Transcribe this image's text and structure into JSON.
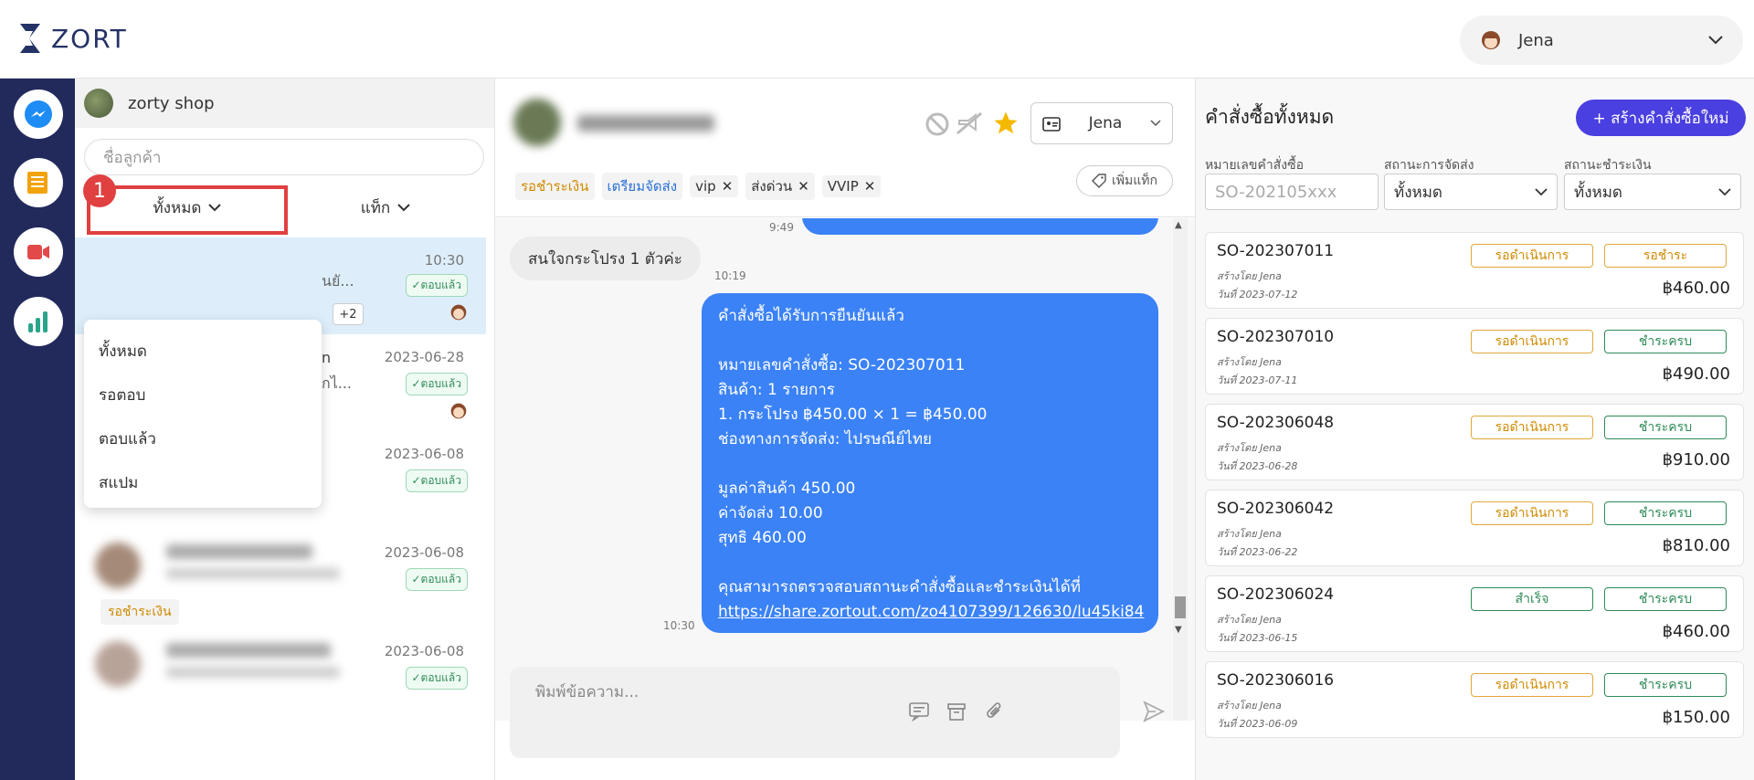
{
  "app": {
    "brand": "ZORT",
    "user_name": "Jena"
  },
  "sidebar": {
    "icons": [
      "messenger-icon",
      "orders-icon",
      "video-icon",
      "chart-icon"
    ]
  },
  "chat_list": {
    "shop_name": "zorty shop",
    "search_placeholder": "ชื่อลูกค้า",
    "filter_all": "ทั้งหมด",
    "filter_tag": "แท็ก",
    "step_badge": "1",
    "dropdown": [
      "ทั้งหมด",
      "รอตอบ",
      "ตอบแล้ว",
      "สแปม"
    ],
    "items": [
      {
        "time": "10:30",
        "preview": "นยั...",
        "status": "✓ตอบแล้ว",
        "extra": "+2"
      },
      {
        "time": "2023-06-28",
        "preview_a": "n",
        "preview_b": "กไ...",
        "status": "✓ตอบแล้ว"
      },
      {
        "time": "2023-06-08",
        "status": "✓ตอบแล้ว"
      },
      {
        "time": "2023-06-08",
        "status": "✓ตอบแล้ว",
        "tag": "รอชำระเงิน"
      },
      {
        "time": "2023-06-08",
        "status": "✓ตอบแล้ว"
      }
    ]
  },
  "chat": {
    "assignee": "Jena",
    "tags": [
      {
        "label": "รอชำระเงิน",
        "removable": false,
        "color": "#d08a00"
      },
      {
        "label": "เตรียมจัดส่ง",
        "removable": false,
        "color": "#2b6fd6"
      },
      {
        "label": "vip",
        "removable": true,
        "color": "#333333"
      },
      {
        "label": "ส่งด่วน",
        "removable": true,
        "color": "#333333"
      },
      {
        "label": "VVIP",
        "removable": true,
        "color": "#333333"
      }
    ],
    "add_tag": "เพิ่มแท็ก",
    "time_top": "9:49",
    "incoming": "สนใจกระโปรง 1 ตัวค่ะ",
    "incoming_time": "10:19",
    "outgoing_time": "10:30",
    "outgoing": {
      "line1": "คำสั่งซื้อได้รับการยืนยันแล้ว",
      "line2": "หมายเลขคำสั่งซื้อ: SO-202307011",
      "line3": "สินค้า: 1 รายการ",
      "line4": "1. กระโปรง ฿450.00 × 1 = ฿450.00",
      "line5": "ช่องทางการจัดส่ง: ไปรษณีย์ไทย",
      "line6": "มูลค่าสินค้า 450.00",
      "line7": "ค่าจัดส่ง 10.00",
      "line8": "สุทธิ 460.00",
      "line9": "คุณสามารถตรวจสอบสถานะคำสั่งซื้อและชำระเงินได้ที่",
      "link": "https://share.zortout.com/zo4107399/126630/lu45ki84"
    },
    "composer_placeholder": "พิมพ์ข้อความ..."
  },
  "orders": {
    "title": "คำสั่งซื้อทั้งหมด",
    "new_button": "+ สร้างคำสั่งซื้อใหม่",
    "filter_order_label": "หมายเลขคำสั่งซื้อ",
    "filter_order_placeholder": "SO-202105xxx",
    "filter_ship_label": "สถานะการจัดส่ง",
    "filter_ship_value": "ทั้งหมด",
    "filter_pay_label": "สถานะชำระเงิน",
    "filter_pay_value": "ทั้งหมด",
    "list": [
      {
        "so": "SO-202307011",
        "by": "สร้างโดย Jena",
        "date": "วันที่ 2023-07-12",
        "ship": "รอดำเนินการ",
        "pay": "รอชำระ",
        "amount": "฿460.00"
      },
      {
        "so": "SO-202307010",
        "by": "สร้างโดย Jena",
        "date": "วันที่ 2023-07-11",
        "ship": "รอดำเนินการ",
        "pay": "ชำระครบ",
        "amount": "฿490.00"
      },
      {
        "so": "SO-202306048",
        "by": "สร้างโดย Jena",
        "date": "วันที่ 2023-06-28",
        "ship": "รอดำเนินการ",
        "pay": "ชำระครบ",
        "amount": "฿910.00"
      },
      {
        "so": "SO-202306042",
        "by": "สร้างโดย Jena",
        "date": "วันที่ 2023-06-22",
        "ship": "รอดำเนินการ",
        "pay": "ชำระครบ",
        "amount": "฿810.00"
      },
      {
        "so": "SO-202306024",
        "by": "สร้างโดย Jena",
        "date": "วันที่ 2023-06-15",
        "ship": "สำเร็จ",
        "pay": "ชำระครบ",
        "amount": "฿460.00"
      },
      {
        "so": "SO-202306016",
        "by": "สร้างโดย Jena",
        "date": "วันที่ 2023-06-09",
        "ship": "รอดำเนินการ",
        "pay": "ชำระครบ",
        "amount": "฿150.00"
      }
    ]
  }
}
